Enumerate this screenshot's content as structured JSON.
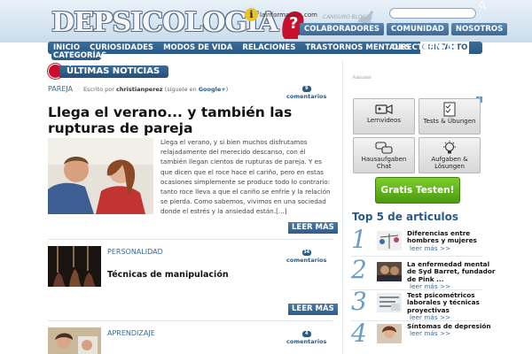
{
  "header": {
    "logo_text": "DEPSICOLOGIA",
    "partner": "lainformacion.com",
    "partner_icon": "i",
    "blog_network": "CANGURO BLOGS",
    "top_links": [
      "COLABORADORES",
      "COMUNIDAD",
      "NOSOTROS"
    ]
  },
  "nav": {
    "items": [
      "INICIO",
      "CURIOSIDADES",
      "MODOS DE VIDA",
      "RELACIONES",
      "TRASTORNOS MENTALES"
    ],
    "active": "CONTACTO",
    "directorio_top": "DIRECTORIO DE",
    "directorio_bottom": "CATEGORÍAS"
  },
  "main": {
    "section_title": "ÚLTIMAS NOTICIAS",
    "featured": {
      "category": "PAREJA",
      "author_prefix": "Escrito por",
      "author": "christianperez",
      "author_suffix_open": "(síguele en",
      "author_google": "Google+",
      "author_suffix_close": ")",
      "comment_count": "9",
      "comments_label": "comentarios",
      "title": "Llega el verano... y también las rupturas de pareja",
      "excerpt": "Llega el verano, y si bien muchos disfrutamos relajadamente del merecido descanso, con él también llegan cientos de rupturas de pareja. Y es que dicen que el roce hace el cariño, pero en estas ocasiones simplemente se produce todo lo contrario: tanto roce lleva a que el cariño se enfríe y la relación se pierda. Como sabemos, vivimos en una sociedad donde el estrés y la ansiedad están.[...]",
      "read_more": "LEER MÁS"
    },
    "second": {
      "category": "PERSONALIDAD",
      "comment_count": "34",
      "comments_label": "comentarios",
      "title": "Técnicas de manipulación",
      "read_more": "LEER MÁS"
    },
    "third": {
      "category": "APRENDIZAJE",
      "comment_count": "4",
      "comments_label": "comentarios"
    }
  },
  "sidebar": {
    "ad_label": "Publicidad",
    "ad_info": "i",
    "tiles": [
      {
        "label": "Lernvideos",
        "icon": "video-camera-icon"
      },
      {
        "label": "Tests & Übungen",
        "icon": "checklist-icon"
      },
      {
        "label": "Hausaufgaben Chat",
        "icon": "chat-bubbles-icon"
      },
      {
        "label": "Aufgaben & Lösungen",
        "icon": "lightbulb-icon"
      }
    ],
    "cta": "Gratis Testen!",
    "top5_title": "Top 5 de articulos",
    "top5": [
      {
        "num": "1",
        "title": "Diferencias entre hombres y mujeres",
        "more": "leer más >>"
      },
      {
        "num": "2",
        "title": "La enfermedad mental de Syd Barret, fundador de Pink ...",
        "more": "leer más >>"
      },
      {
        "num": "3",
        "title": "Test psicométricos laborales y técnicas proyectivas",
        "more": "leer más >>"
      },
      {
        "num": "4",
        "title": "Síntomas de depresión",
        "more": "leer más >>"
      }
    ]
  }
}
